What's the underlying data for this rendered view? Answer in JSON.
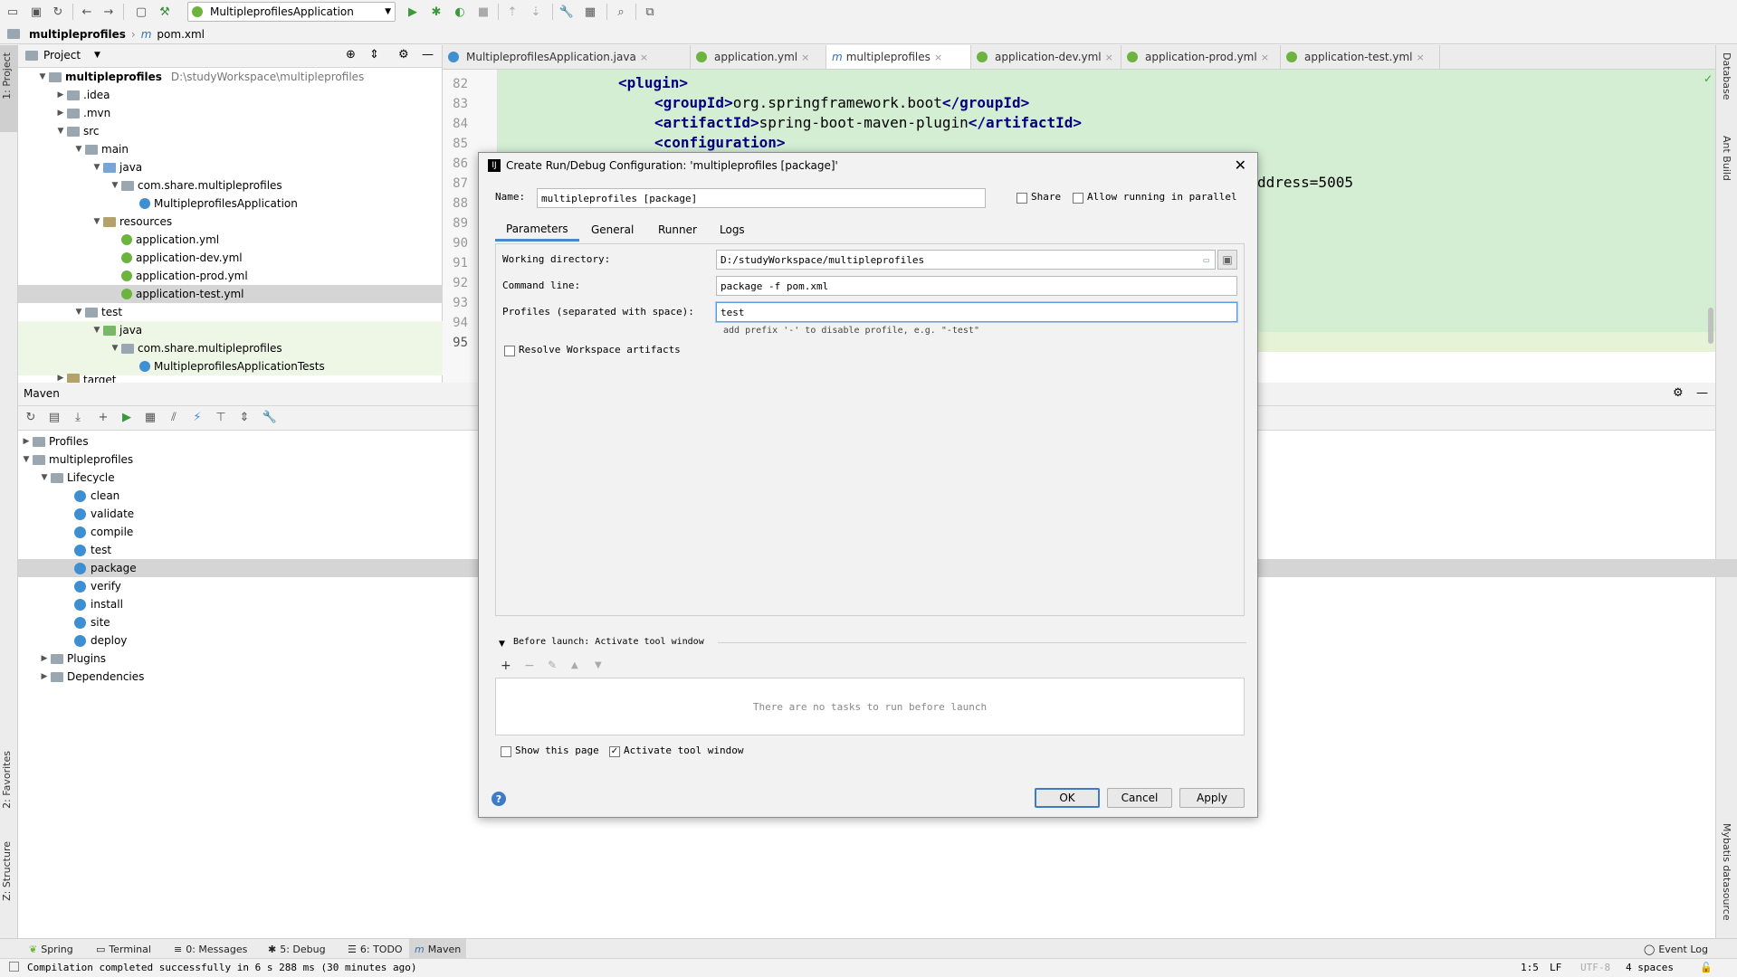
{
  "toolbar": {
    "run_config": "MultipleprofilesApplication"
  },
  "breadcrumb": {
    "project": "multipleprofiles",
    "file_prefix": "m",
    "file": "pom.xml"
  },
  "left_strip": {
    "project_tab": "1: Project",
    "favorites_tab": "2: Favorites",
    "structure_tab": "Z: Structure"
  },
  "right_strip": {
    "database": "Database",
    "ant": "Ant Build",
    "mybatis": "Mybatis datasource"
  },
  "project_panel": {
    "title": "Project",
    "tree": [
      {
        "label": "multipleprofiles",
        "extra": "D:\\studyWorkspace\\multipleprofiles"
      },
      {
        "label": ".idea"
      },
      {
        "label": ".mvn"
      },
      {
        "label": "src"
      },
      {
        "label": "main"
      },
      {
        "label": "java"
      },
      {
        "label": "com.share.multipleprofiles"
      },
      {
        "label": "MultipleprofilesApplication"
      },
      {
        "label": "resources"
      },
      {
        "label": "application.yml"
      },
      {
        "label": "application-dev.yml"
      },
      {
        "label": "application-prod.yml"
      },
      {
        "label": "application-test.yml"
      },
      {
        "label": "test"
      },
      {
        "label": "java"
      },
      {
        "label": "com.share.multipleprofiles"
      },
      {
        "label": "MultipleprofilesApplicationTests"
      },
      {
        "label": "target"
      }
    ]
  },
  "editor": {
    "tabs": [
      {
        "label": "MultipleprofilesApplication.java"
      },
      {
        "label": "application.yml"
      },
      {
        "label": "multipleprofiles",
        "prefix": "m"
      },
      {
        "label": "application-dev.yml"
      },
      {
        "label": "application-prod.yml"
      },
      {
        "label": "application-test.yml"
      }
    ],
    "line_numbers": [
      "82",
      "83",
      "84",
      "85",
      "86",
      "87",
      "88",
      "89",
      "90",
      "91",
      "92",
      "93",
      "94",
      "95"
    ],
    "code": {
      "l82": "<plugin>",
      "l83_open": "<groupId>",
      "l83_text": "org.springframework.boot",
      "l83_close": "</groupId>",
      "l84_open": "<artifactId>",
      "l84_text": "spring-boot-maven-plugin",
      "l84_close": "</artifactId>",
      "l85": "<configuration>",
      "l86_tail": "ddress=5005"
    }
  },
  "maven": {
    "title": "Maven",
    "tree": [
      {
        "label": "Profiles"
      },
      {
        "label": "multipleprofiles"
      },
      {
        "label": "Lifecycle"
      },
      {
        "label": "clean"
      },
      {
        "label": "validate"
      },
      {
        "label": "compile"
      },
      {
        "label": "test"
      },
      {
        "label": "package"
      },
      {
        "label": "verify"
      },
      {
        "label": "install"
      },
      {
        "label": "site"
      },
      {
        "label": "deploy"
      },
      {
        "label": "Plugins"
      },
      {
        "label": "Dependencies"
      }
    ]
  },
  "dialog": {
    "title": "Create Run/Debug Configuration: 'multipleprofiles [package]'",
    "name_label": "Name:",
    "name_value": "multipleprofiles [package]",
    "share_label": "Share",
    "parallel_label": "Allow running in parallel",
    "tabs": [
      "Parameters",
      "General",
      "Runner",
      "Logs"
    ],
    "working_dir_label": "Working directory:",
    "working_dir_value": "D:/studyWorkspace/multipleprofiles",
    "command_line_label": "Command line:",
    "command_line_value": "package -f pom.xml",
    "profiles_label": "Profiles (separated with space):",
    "profiles_value": "test",
    "profiles_hint": "add prefix '-' to disable profile, e.g. \"-test\"",
    "resolve_label": "Resolve Workspace artifacts",
    "before_launch_label": "Before launch: Activate tool window",
    "no_tasks": "There are no tasks to run before launch",
    "show_page_label": "Show this page",
    "activate_label": "Activate tool window",
    "ok": "OK",
    "cancel": "Cancel",
    "apply": "Apply"
  },
  "bottom_tabs": [
    {
      "label": "Spring"
    },
    {
      "label": "Terminal"
    },
    {
      "label": "0: Messages"
    },
    {
      "label": "5: Debug"
    },
    {
      "label": "6: TODO"
    },
    {
      "label": "Maven"
    }
  ],
  "event_log": "Event Log",
  "status": {
    "message": "Compilation completed successfully in 6 s 288 ms (30 minutes ago)",
    "position": "1:5",
    "line_sep": "LF",
    "encoding": "UTF-8",
    "indent": "4 spaces"
  }
}
